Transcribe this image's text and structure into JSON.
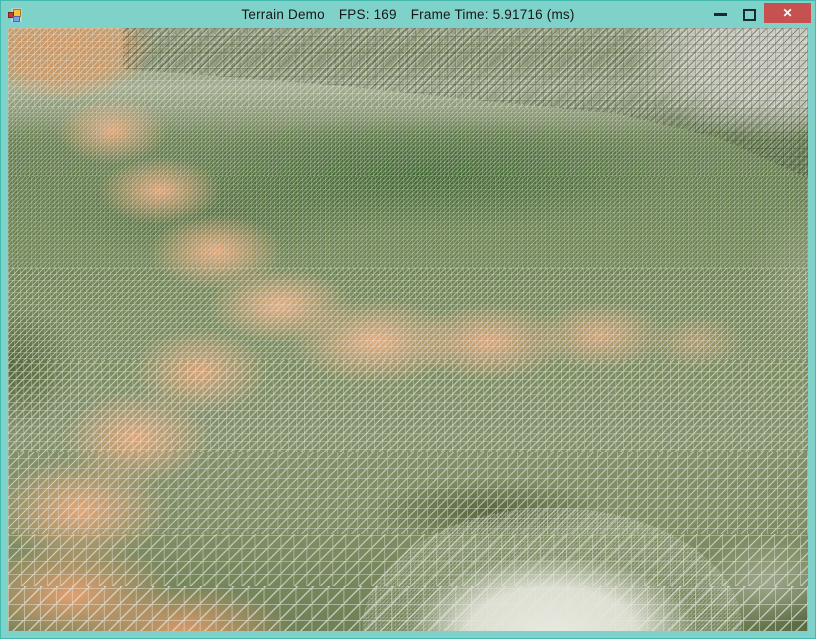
{
  "window": {
    "title": "Terrain Demo",
    "fps_counter": "FPS: 169",
    "frame_time": "Frame Time: 5.91716 (ms)",
    "controls": {
      "close_glyph": "✕"
    },
    "app_icon": "winforms-default-app-icon"
  },
  "theme": {
    "colors": {
      "titlebar": "#7fd2ca",
      "window-edge": "#43b9ae",
      "title-text": "#161616",
      "glyph": "#1c2b29",
      "close-red": "#c75150",
      "close-x": "#ffffff",
      "mesh-light": "#e6e7dc",
      "mesh-dark": "#2a3026",
      "grass-base": "#75885a",
      "grass-dark": "#3d6333",
      "sage-distant": "#a9ae97",
      "dirt-orange": "#e9a77a",
      "dirt-deep": "#d29864",
      "rock-light": "#cdcdc5",
      "snow-white": "#ecece4",
      "corner-green": "#45572f"
    }
  },
  "scene": {
    "kind": "3d-terrain-wireframe-render"
  }
}
